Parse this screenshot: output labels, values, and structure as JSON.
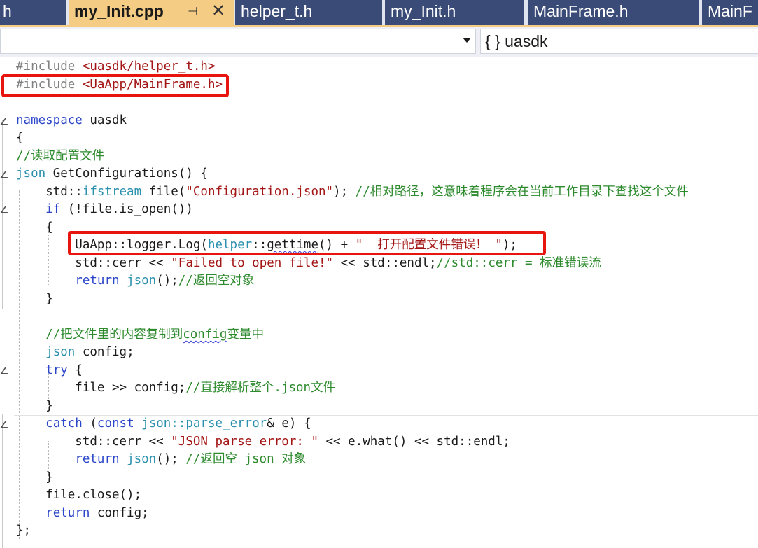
{
  "tabs": [
    {
      "label": "h"
    },
    {
      "label": "my_Init.cpp"
    },
    {
      "label": "helper_t.h"
    },
    {
      "label": "my_Init.h"
    },
    {
      "label": "MainFrame.h"
    },
    {
      "label": "MainF"
    }
  ],
  "tab_icons": {
    "pin": "pin-icon",
    "close": "close-icon"
  },
  "navbar": {
    "left_selector": "",
    "right_selector": "{ } uasdk"
  },
  "colors": {
    "active_tab": "#f5cc84",
    "inactive_tab": "#3b4b77",
    "keyword": "#2b46c9",
    "string": "#a31515",
    "comment": "#2d8a2d",
    "highlight_box": "#e8150f"
  },
  "code": {
    "l1_a": "#include ",
    "l1_b": "<uasdk/helper_t.h>",
    "l2_a": "#include ",
    "l2_b": "<UaApp/MainFrame.h>",
    "l4_kw": "namespace",
    "l4_b": " uasdk",
    "l5": "{",
    "l6": "//读取配置文件",
    "l7_ty": "json",
    "l7_b": " GetConfigurations() {",
    "l8_a": "    std::",
    "l8_ty": "ifstream",
    "l8_b": " file(",
    "l8_str": "\"Configuration.json\"",
    "l8_c": "); ",
    "l8_cmt": "//相对路径，这意味着程序会在当前工作目录下查找这个文件",
    "l9_a": "    ",
    "l9_kw": "if",
    "l9_b": " (!file.is_open())",
    "l10": "    {",
    "l11_a": "        UaApp::logger.Log(",
    "l11_ty": "helper",
    "l11_b": "::",
    "l11_sq": "gettime",
    "l11_c": "() + ",
    "l11_str": "\"  打开配置文件错误！ \"",
    "l11_d": ");",
    "l12_a": "        std::cerr << ",
    "l12_str": "\"Failed to open file!\"",
    "l12_b": " << std::endl;",
    "l12_cmt": "//std::cerr = 标准错误流",
    "l13_a": "        ",
    "l13_kw": "return",
    "l13_sp": " ",
    "l13_ty": "json",
    "l13_b": "();",
    "l13_cmt": "//返回空对象",
    "l14": "    }",
    "l16_a": "    ",
    "l16_c1": "//把文件里的内容复制到",
    "l16_sq": "config",
    "l16_c2": "变量中",
    "l17_a": "    ",
    "l17_ty": "json",
    "l17_b": " config;",
    "l18_a": "    ",
    "l18_kw": "try",
    "l18_b": " {",
    "l19_a": "        file >> config;",
    "l19_cmt": "//直接解析整个.json文件",
    "l20": "    }",
    "l21_a": "    ",
    "l21_kw": "catch",
    "l21_b": " (",
    "l21_kw2": "const",
    "l21_sp": " ",
    "l21_ty": "json::parse_error",
    "l21_c": "& e) {",
    "l22_a": "        std::cerr << ",
    "l22_str": "\"JSON parse error: \"",
    "l22_b": " << e.what() << std::endl;",
    "l23_a": "        ",
    "l23_kw": "return",
    "l23_sp": " ",
    "l23_ty": "json",
    "l23_b": "(); ",
    "l23_cmt": "//返回空 json 对象",
    "l24": "    }",
    "l25": "    file.close();",
    "l26_a": "    ",
    "l26_kw": "return",
    "l26_b": " config;",
    "l27": "};"
  }
}
